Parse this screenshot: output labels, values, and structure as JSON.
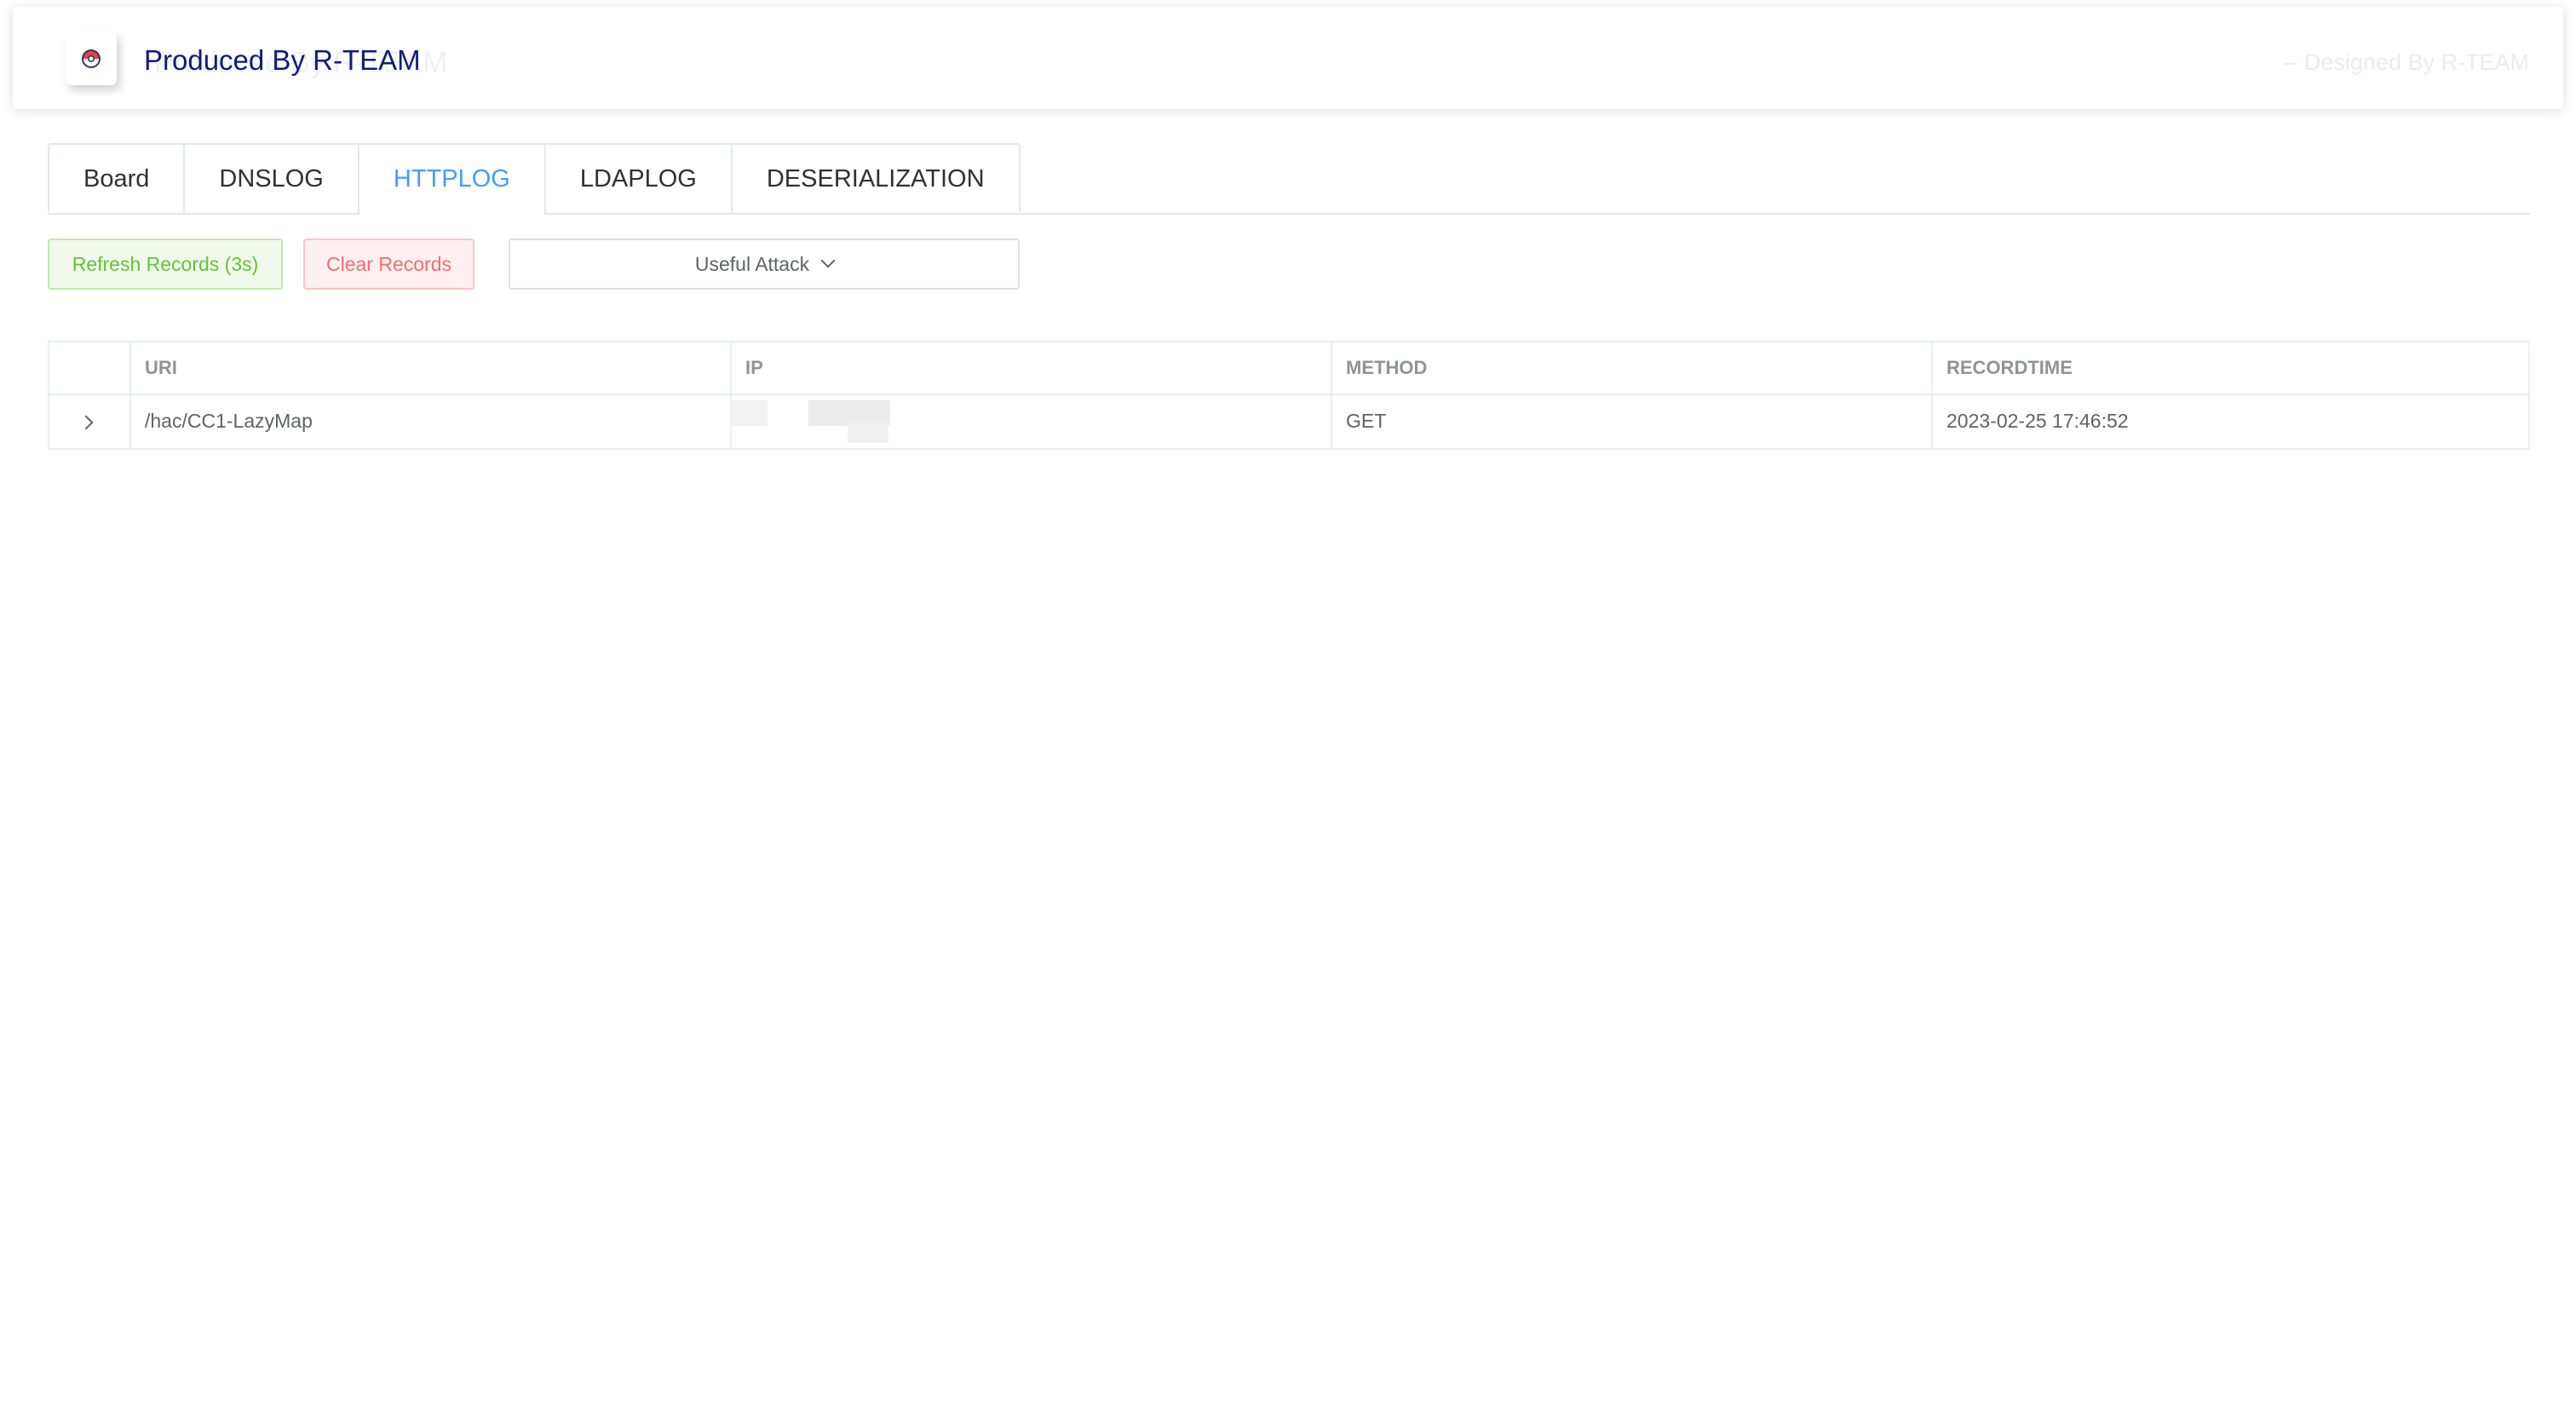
{
  "header": {
    "title": "Produced By R-TEAM",
    "designed_by": "-- Designed By R-TEAM",
    "logo_icon": "pokeball-icon"
  },
  "tabs": [
    {
      "label": "Board",
      "active": false
    },
    {
      "label": "DNSLOG",
      "active": false
    },
    {
      "label": "HTTPLOG",
      "active": true
    },
    {
      "label": "LDAPLOG",
      "active": false
    },
    {
      "label": "DESERIALIZATION",
      "active": false
    }
  ],
  "toolbar": {
    "refresh_label": "Refresh Records (3s)",
    "clear_label": "Clear Records",
    "attack_label": "Useful Attack"
  },
  "table": {
    "columns": [
      "URI",
      "IP",
      "METHOD",
      "RECORDTIME"
    ],
    "rows": [
      {
        "uri": "/hac/CC1-LazyMap",
        "ip": "",
        "method": "GET",
        "recordtime": "2023-02-25 17:46:52"
      }
    ]
  },
  "colors": {
    "accent": "#409eff",
    "title": "#0f1d7a",
    "success": "#67c23a",
    "danger": "#f56c6c"
  }
}
